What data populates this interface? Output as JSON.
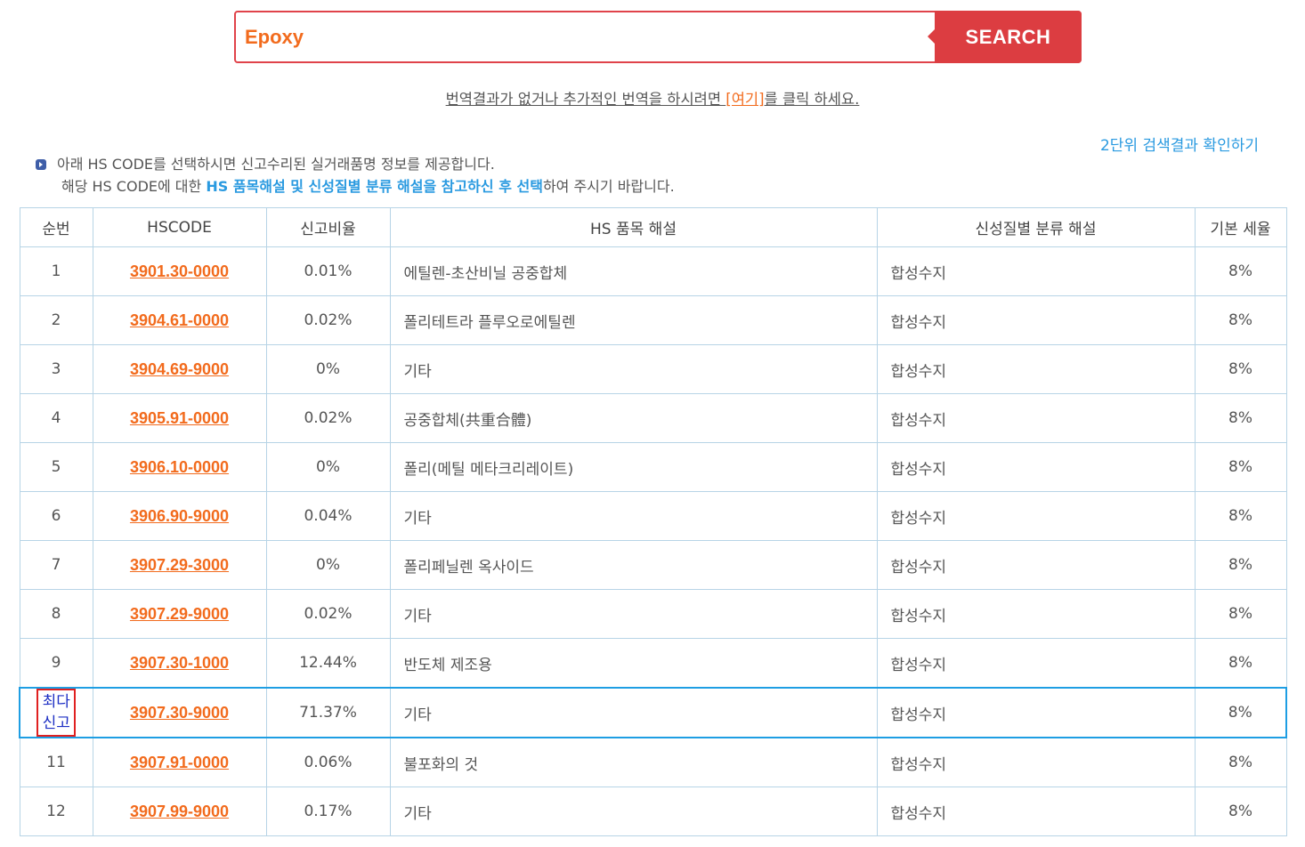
{
  "search": {
    "value": "Epoxy",
    "button_label": "SEARCH"
  },
  "notice": {
    "text_before": "번역결과가 없거나 추가적인 번역을 하시려면 ",
    "link_label": "[여기]",
    "text_after": "를 클릭 하세요."
  },
  "link_2digit": "2단위 검색결과 확인하기",
  "info": {
    "line1": "아래 HS CODE를 선택하시면 신고수리된 실거래품명 정보를 제공합니다.",
    "line2_before": "해당 HS CODE에 대한 ",
    "line2_highlight": "HS 품목해설 및 신성질별 분류 해설을 참고하신 후 선택",
    "line2_after": "하여 주시기 바랍니다."
  },
  "table": {
    "headers": [
      "순번",
      "HSCODE",
      "신고비율",
      "HS 품목 해설",
      "신성질별 분류 해설",
      "기본 세율"
    ],
    "rows": [
      {
        "no": "1",
        "code": "3901.30-0000",
        "ratio": "0.01%",
        "desc": "에틸렌-초산비닐 공중합체",
        "class": "합성수지",
        "rate": "8%"
      },
      {
        "no": "2",
        "code": "3904.61-0000",
        "ratio": "0.02%",
        "desc": "폴리테트라 플루오로에틸렌",
        "class": "합성수지",
        "rate": "8%"
      },
      {
        "no": "3",
        "code": "3904.69-9000",
        "ratio": "0%",
        "desc": "기타",
        "class": "합성수지",
        "rate": "8%"
      },
      {
        "no": "4",
        "code": "3905.91-0000",
        "ratio": "0.02%",
        "desc": "공중합체(共重合體)",
        "class": "합성수지",
        "rate": "8%"
      },
      {
        "no": "5",
        "code": "3906.10-0000",
        "ratio": "0%",
        "desc": "폴리(메틸 메타크리레이트)",
        "class": "합성수지",
        "rate": "8%"
      },
      {
        "no": "6",
        "code": "3906.90-9000",
        "ratio": "0.04%",
        "desc": "기타",
        "class": "합성수지",
        "rate": "8%"
      },
      {
        "no": "7",
        "code": "3907.29-3000",
        "ratio": "0%",
        "desc": "폴리페닐렌 옥사이드",
        "class": "합성수지",
        "rate": "8%"
      },
      {
        "no": "8",
        "code": "3907.29-9000",
        "ratio": "0.02%",
        "desc": "기타",
        "class": "합성수지",
        "rate": "8%"
      },
      {
        "no": "9",
        "code": "3907.30-1000",
        "ratio": "12.44%",
        "desc": "반도체 제조용",
        "class": "합성수지",
        "rate": "8%"
      },
      {
        "no_line1": "최다",
        "no_line2": "신고",
        "code": "3907.30-9000",
        "ratio": "71.37%",
        "desc": "기타",
        "class": "합성수지",
        "rate": "8%"
      },
      {
        "no": "11",
        "code": "3907.91-0000",
        "ratio": "0.06%",
        "desc": "불포화의 것",
        "class": "합성수지",
        "rate": "8%"
      },
      {
        "no": "12",
        "code": "3907.99-9000",
        "ratio": "0.17%",
        "desc": "기타",
        "class": "합성수지",
        "rate": "8%"
      }
    ]
  },
  "colors": {
    "accent_orange": "#f26b1d",
    "search_red": "#dc3d41",
    "link_blue": "#2a9ae0",
    "highlight_row_border": "#1e9ee3",
    "most_badge_red": "#e02020"
  }
}
